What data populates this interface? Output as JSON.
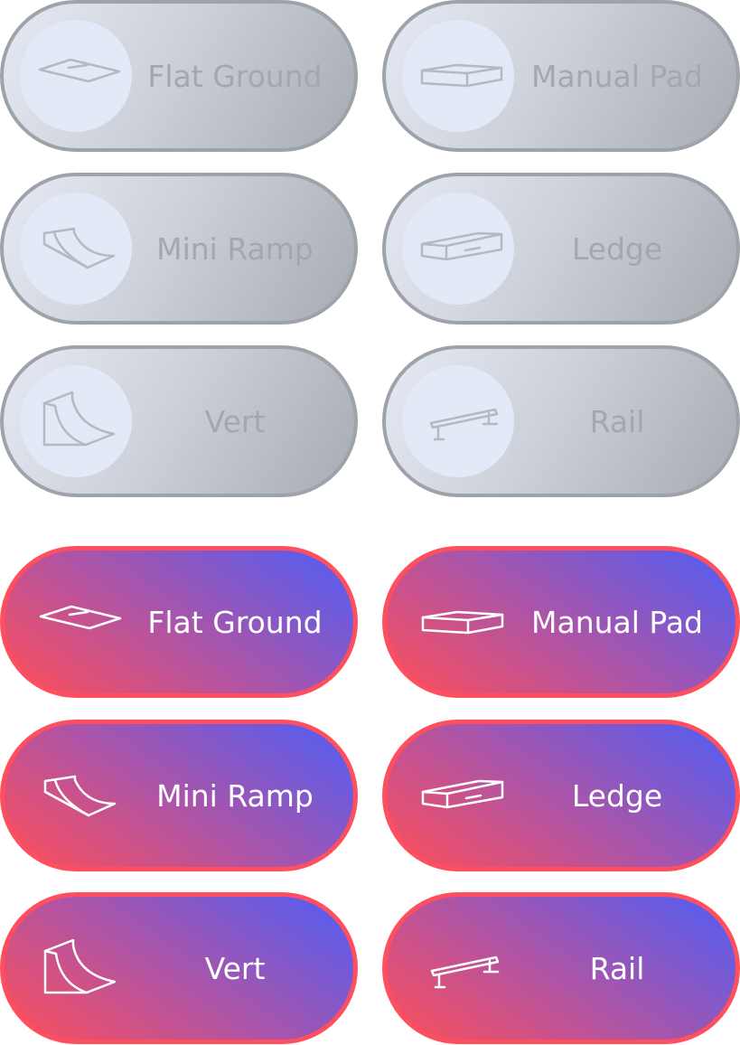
{
  "buttons_inactive": [
    {
      "label": "Flat Ground",
      "icon": "flat-ground-icon"
    },
    {
      "label": "Manual Pad",
      "icon": "manual-pad-icon"
    },
    {
      "label": "Mini Ramp",
      "icon": "mini-ramp-icon"
    },
    {
      "label": "Ledge",
      "icon": "ledge-icon"
    },
    {
      "label": "Vert",
      "icon": "vert-icon"
    },
    {
      "label": "Rail",
      "icon": "rail-icon"
    }
  ],
  "buttons_active": [
    {
      "label": "Flat Ground",
      "icon": "flat-ground-icon"
    },
    {
      "label": "Manual Pad",
      "icon": "manual-pad-icon"
    },
    {
      "label": "Mini Ramp",
      "icon": "mini-ramp-icon"
    },
    {
      "label": "Ledge",
      "icon": "ledge-icon"
    },
    {
      "label": "Vert",
      "icon": "vert-icon"
    },
    {
      "label": "Rail",
      "icon": "rail-icon"
    }
  ],
  "colors": {
    "inactive_border": "#9ea3aa",
    "inactive_text": "#a3a8b0",
    "active_border": "#ff4f5e",
    "active_gradient_start": "#ff4e58",
    "active_gradient_end": "#4f5ef6",
    "active_text": "#ffffff"
  }
}
